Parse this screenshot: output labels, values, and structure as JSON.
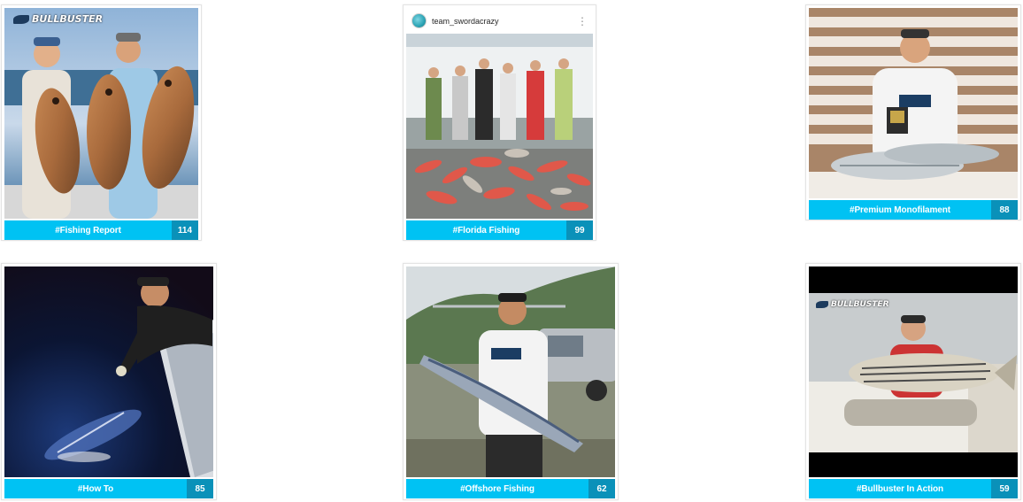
{
  "colors": {
    "accent": "#00c2f3",
    "accent_dark": "#0a91b9"
  },
  "cards": [
    {
      "tag": "#Fishing Report",
      "count": "114",
      "logo": "BULLBUSTER"
    },
    {
      "tag": "#Florida Fishing",
      "count": "99",
      "username": "team_swordacrazy"
    },
    {
      "tag": "#Premium Monofilament",
      "count": "88"
    },
    {
      "tag": "#How To",
      "count": "85"
    },
    {
      "tag": "#Offshore Fishing",
      "count": "62"
    },
    {
      "tag": "#Bullbuster In Action",
      "count": "59",
      "logo": "BULLBUSTER"
    }
  ]
}
